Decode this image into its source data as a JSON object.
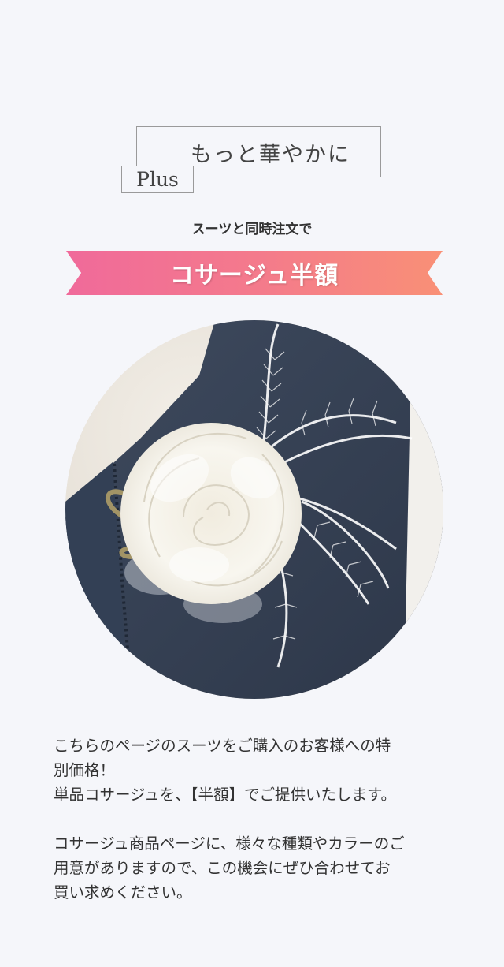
{
  "heading": {
    "title": "もっと華やかに",
    "plus": "Plus"
  },
  "subtitle": "スーツと同時注文で",
  "banner": {
    "text": "コサージュ半額",
    "color_start": "#f06a9a",
    "color_end": "#f99076"
  },
  "photo": {
    "subject": "white rose corsage with feathers on navy jacket"
  },
  "body": {
    "paragraph1_line1": "こちらのページのスーツをご購入のお客様への特",
    "paragraph1_line2": "別価格！",
    "paragraph1_line3": "単品コサージュを、【半額】でご提供いたします。",
    "paragraph2_line1": "コサージュ商品ページに、様々な種類やカラーのご",
    "paragraph2_line2": "用意がありますので、この機会にぜひ合わせてお",
    "paragraph2_line3": "買い求めください。"
  }
}
